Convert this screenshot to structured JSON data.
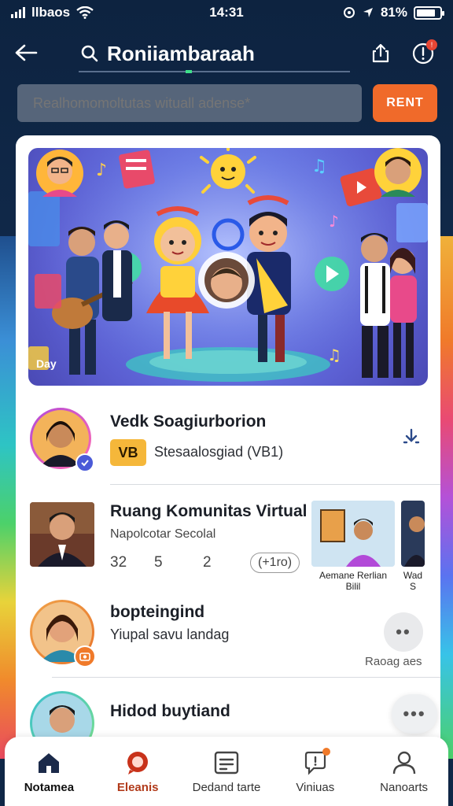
{
  "status_bar": {
    "carrier": "llbaos",
    "time": "14:31",
    "battery_text": "81%",
    "battery_level": 0.81
  },
  "header": {
    "search_title": "Roniiambaraah",
    "icons": [
      "back-arrow-icon",
      "search-icon",
      "share-icon",
      "notification-icon"
    ]
  },
  "search": {
    "placeholder": "Realhomomoltutas wituall adense*",
    "button_label": "RENT"
  },
  "hero": {
    "label": "Day"
  },
  "feed": [
    {
      "title": "Vedk Soagiurborion",
      "tag": "VB",
      "subtitle": "Stesaalosgiad (VB1)",
      "action_icon": "download-icon"
    },
    {
      "title": "Ruang Komunitas Virtual",
      "subtitle": "Napolcotar Secolal",
      "metrics": [
        "32",
        "5",
        "2"
      ],
      "pill": "(+1ro)",
      "thumb_captions": [
        "Aemane Rerlian Bilil",
        "Wad S"
      ]
    },
    {
      "title": "bopteingind",
      "subtitle": "Yiupal savu landag",
      "side_caption": "Raoag aes",
      "side_button": "••"
    },
    {
      "title": "Hidod buytiand",
      "side_button": "•••"
    }
  ],
  "bottom_nav": [
    {
      "label": "Notamea",
      "icon": "home-icon"
    },
    {
      "label": "Eleanis",
      "icon": "chat-bubble-icon"
    },
    {
      "label": "Dedand tarte",
      "icon": "document-icon"
    },
    {
      "label": "Viniuas",
      "icon": "notification-icon"
    },
    {
      "label": "Nanoarts",
      "icon": "profile-icon"
    }
  ],
  "colors": {
    "accent": "#f06a2a",
    "navy": "#0d2340",
    "tag": "#f5b73a"
  }
}
